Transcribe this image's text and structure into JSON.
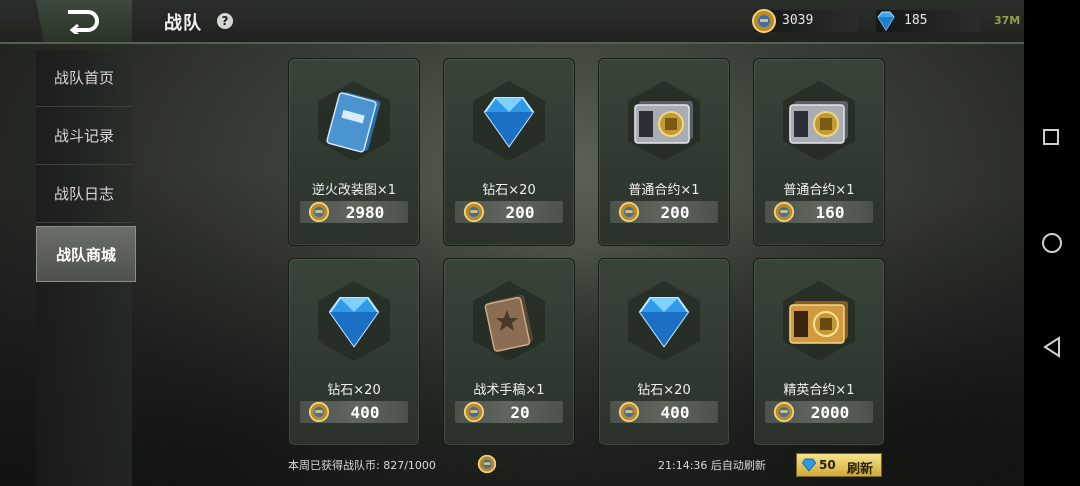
{
  "header": {
    "title": "战队",
    "help_label": "?"
  },
  "currencies": {
    "coins": "3039",
    "diamonds": "185"
  },
  "status_text": "37M",
  "sidebar": {
    "items": [
      {
        "label": "战队首页"
      },
      {
        "label": "战斗记录"
      },
      {
        "label": "战队日志"
      },
      {
        "label": "战队商城",
        "active": true
      }
    ]
  },
  "shop": {
    "items": [
      {
        "name": "逆火改装图×1",
        "price": "2980",
        "icon": "blueprint-icon"
      },
      {
        "name": "钻石×20",
        "price": "200",
        "icon": "diamond-icon"
      },
      {
        "name": "普通合约×1",
        "price": "200",
        "icon": "contract-icon"
      },
      {
        "name": "普通合约×1",
        "price": "160",
        "icon": "contract-icon"
      },
      {
        "name": "钻石×20",
        "price": "400",
        "icon": "diamond-icon"
      },
      {
        "name": "战术手稿×1",
        "price": "20",
        "icon": "book-icon"
      },
      {
        "name": "钻石×20",
        "price": "400",
        "icon": "diamond-icon"
      },
      {
        "name": "精英合约×1",
        "price": "2000",
        "icon": "elite-contract-icon"
      }
    ]
  },
  "footer": {
    "weekly_text": "本周已获得战队币: 827/1000",
    "refresh_timer": "21:14:36 后自动刷新",
    "refresh_cost": "50",
    "refresh_label": "刷新"
  },
  "colors": {
    "accent_gold": "#d0aa3a",
    "diamond_blue": "#2f9be8",
    "status_green": "#8ea24a"
  }
}
